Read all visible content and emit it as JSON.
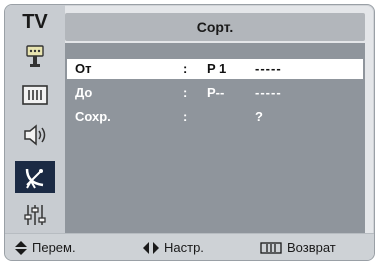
{
  "osd": {
    "category": "TV",
    "title": "Сорт.",
    "rows": [
      {
        "name": "От",
        "colon": ":",
        "prog": "P 1",
        "value": "-----",
        "selected": true
      },
      {
        "name": "До",
        "colon": ":",
        "prog": "P--",
        "value": "-----",
        "selected": false
      },
      {
        "name": "Сохр.",
        "colon": ":",
        "prog": "",
        "value": "?",
        "selected": false
      }
    ]
  },
  "sidebar": {
    "icons": [
      "input-icon",
      "picture-icon",
      "sound-icon",
      "channel-icon",
      "setup-icon"
    ],
    "active": "channel-icon"
  },
  "footer": {
    "move_label": "Перем.",
    "adjust_label": "Настр.",
    "return_label": "Возврат"
  },
  "colors": {
    "panel_bg": "#8f959c",
    "active_icon_bg": "#1b2a44",
    "selected_row_bg": "#ffffff"
  }
}
